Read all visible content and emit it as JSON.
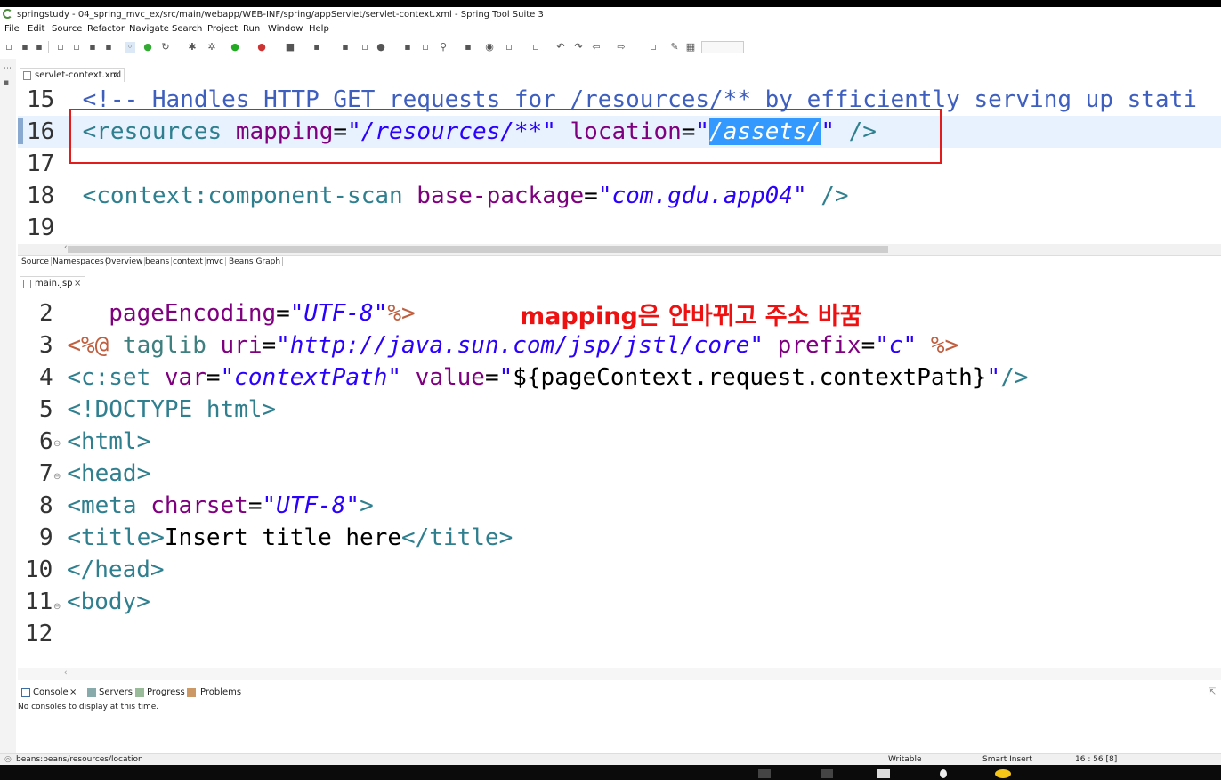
{
  "window": {
    "title": "springstudy - 04_spring_mvc_ex/src/main/webapp/WEB-INF/spring/appServlet/servlet-context.xml - Spring Tool Suite 3"
  },
  "menu": [
    "File",
    "Edit",
    "Source",
    "Refactor",
    "Navigate",
    "Search",
    "Project",
    "Run",
    "Window",
    "Help"
  ],
  "editor_top": {
    "tab": "servlet-context.xml",
    "lines": [
      {
        "num": "15",
        "comment": "<!-- Handles HTTP GET requests for /resources/** by efficiently serving up stati"
      },
      {
        "num": "16",
        "open": "<resources",
        "attr1": " mapping",
        "eq1": "=",
        "val1": "\"/resources/**\"",
        "attr2": " location",
        "eq2": "=",
        "q": "\"",
        "val2": "/assets/",
        "q2": "\"",
        "close": " />"
      },
      {
        "num": "17"
      },
      {
        "num": "18",
        "open": "<context:component-scan",
        "attr1": " base-package",
        "eq1": "=",
        "val1": "\"com.gdu.app04\"",
        "close": " />"
      },
      {
        "num": "19"
      }
    ],
    "subtabs": [
      "Source",
      "Namespaces",
      "Overview",
      "beans",
      "context",
      "mvc",
      "Beans Graph"
    ]
  },
  "editor_bottom": {
    "tab": "main.jsp",
    "lines": [
      {
        "num": "2",
        "indent": "   ",
        "attr": "pageEncoding",
        "eq": "=",
        "val": "\"UTF-8\"",
        "close": "%>"
      },
      {
        "num": "3",
        "open": "<%@",
        "kw": " taglib",
        "attr": " uri",
        "eq": "=",
        "val": "\"http://java.sun.com/jsp/jstl/core\"",
        "attr2": " prefix",
        "eq2": "=",
        "val2": "\"c\"",
        "close": " %>"
      },
      {
        "num": "4",
        "open": "<c:set",
        "attr": " var",
        "eq": "=",
        "val": "\"contextPath\"",
        "attr2": " value",
        "eq2": "=",
        "q": "\"",
        "text": "${pageContext.request.contextPath}",
        "val2": "\"",
        "close": "/>"
      },
      {
        "num": "5",
        "open": "<!DOCTYPE html>"
      },
      {
        "num": "6",
        "open": "<html>"
      },
      {
        "num": "7",
        "open": "<head>"
      },
      {
        "num": "8",
        "open": "<meta",
        "attr": " charset",
        "eq": "=",
        "val": "\"UTF-8\"",
        "close": ">"
      },
      {
        "num": "9",
        "open": "<title>",
        "text": "Insert title here",
        "close": "</title>"
      },
      {
        "num": "10",
        "open": "</head>"
      },
      {
        "num": "11",
        "open": "<body>"
      },
      {
        "num": "12"
      }
    ],
    "annotation": "mapping은 안바뀌고 주소 바꿈"
  },
  "console": {
    "tabs": [
      "Console",
      "Servers",
      "Progress",
      "Problems"
    ],
    "message": "No consoles to display at this time."
  },
  "status": {
    "path": "beans:beans/resources/location",
    "writable": "Writable",
    "insert": "Smart Insert",
    "position": "16 : 56 [8]"
  },
  "colors": {
    "tag": "#2f7f8f",
    "attribute": "#7f007f",
    "string": "#2a00ff",
    "comment": "#3f5fbf",
    "annotation": "#ee1111",
    "highlight_box": "#e21b1b",
    "selection": "#3399ff"
  }
}
